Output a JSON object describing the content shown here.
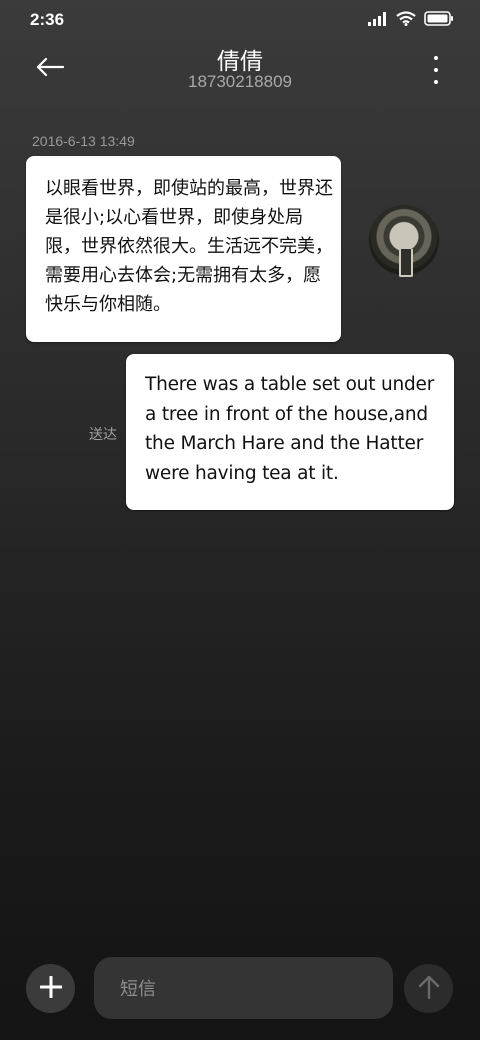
{
  "status_bar": {
    "time": "2:36"
  },
  "header": {
    "contact_name": "倩倩",
    "contact_number": "18730218809"
  },
  "conversation": {
    "timestamp": "2016-6-13 13:49",
    "incoming_message": "以眼看世界，即使站的最高，世界还是很小;以心看世界，即使身处局限，世界依然很大。生活远不完美，需要用心去体会;无需拥有太多，愿快乐与你相随。",
    "outgoing_message": "There was a table set out under a tree in front of the house,and the March Hare and the Hatter were having tea at it.",
    "outgoing_status": "送达"
  },
  "composer": {
    "placeholder": "短信"
  },
  "icons": {
    "back": "back-arrow-icon",
    "more": "more-vertical-icon",
    "add": "plus-icon",
    "send": "send-arrow-up-icon",
    "signal": "signal-icon",
    "wifi": "wifi-icon",
    "battery": "battery-icon"
  },
  "colors": {
    "bubble": "#ffffff",
    "background_top": "#3b3b3b",
    "background_bottom": "#141414",
    "muted_text": "#9a9a9a"
  }
}
